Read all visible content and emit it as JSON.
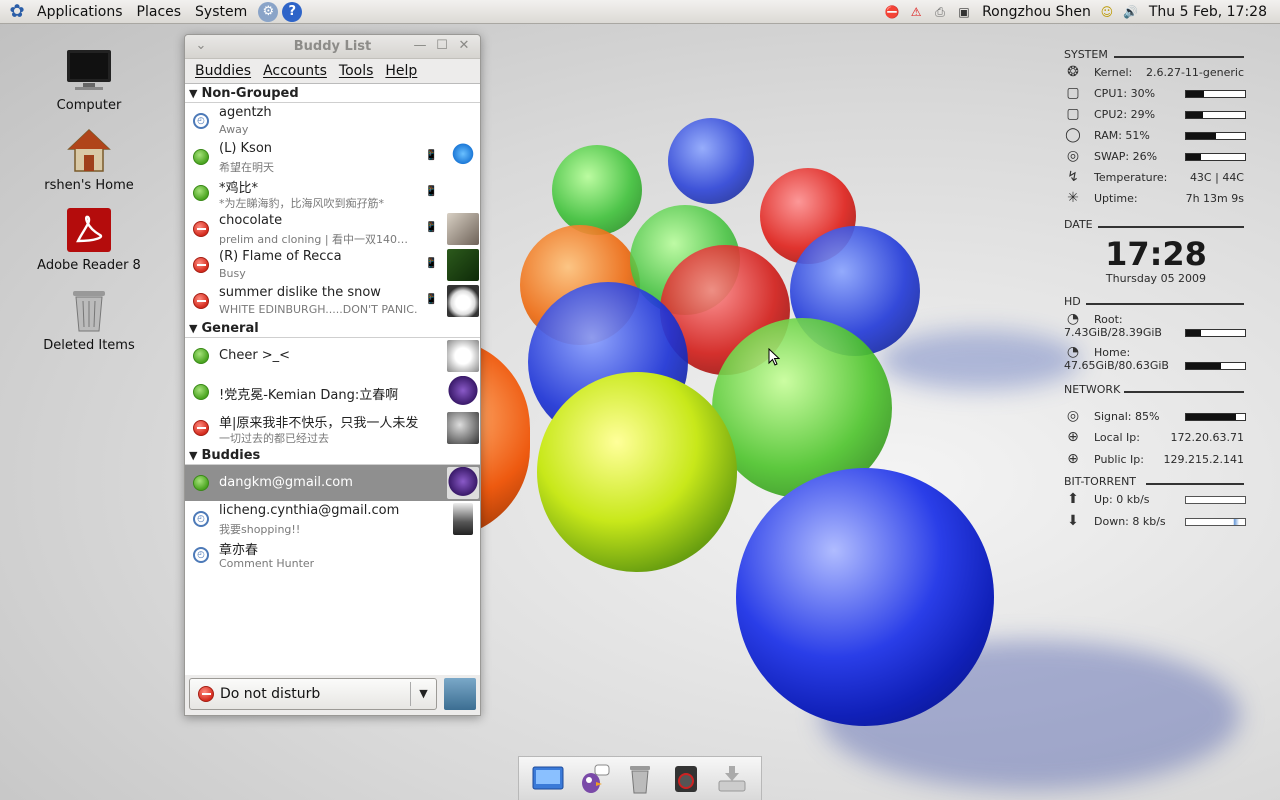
{
  "top_panel": {
    "menus": [
      "Applications",
      "Places",
      "System"
    ],
    "user_name": "Rongzhou Shen",
    "clock": "Thu  5 Feb, 17:28"
  },
  "desktop": {
    "icons": [
      {
        "label": "Computer",
        "icon": "computer-icon"
      },
      {
        "label": "rshen's Home",
        "icon": "home-folder-icon"
      },
      {
        "label": "Adobe Reader 8",
        "icon": "adobe-reader-icon"
      },
      {
        "label": "Deleted Items",
        "icon": "trash-icon"
      }
    ]
  },
  "buddy_window": {
    "title": "Buddy List",
    "menu": [
      "Buddies",
      "Accounts",
      "Tools",
      "Help"
    ],
    "groups": [
      {
        "name": "Non-Grouped",
        "buddies": [
          {
            "name": "agentzh",
            "status_text": "Away",
            "status": "away",
            "mobile": false,
            "avatar": "none"
          },
          {
            "name": "(L) Kson",
            "status_text": "希望在明天",
            "status": "available",
            "mobile": true,
            "avatar": "logo"
          },
          {
            "name": "*鸡比*",
            "status_text": "*为左睇海豹，比海风吹到痴孖筋*",
            "status": "available",
            "mobile": true,
            "avatar": "none"
          },
          {
            "name": "chocolate",
            "status_text": "prelim and cloning | 看中一双140…",
            "status": "busy",
            "mobile": true,
            "avatar": "photo"
          },
          {
            "name": "(R) Flame of Recca",
            "status_text": "Busy",
            "status": "busy",
            "mobile": true,
            "avatar": "green-photo"
          },
          {
            "name": "summer dislike the snow",
            "status_text": "WHITE EDINBURGH.....DON'T PANIC.",
            "status": "busy",
            "mobile": true,
            "avatar": "dog"
          }
        ]
      },
      {
        "name": "General",
        "buddies": [
          {
            "name": "Cheer >_<",
            "status_text": "",
            "status": "available",
            "mobile": false,
            "avatar": "rabbit"
          },
          {
            "name": "!党克冕-Kemian Dang:立春啊",
            "status_text": "",
            "status": "available",
            "mobile": false,
            "avatar": "dragon"
          },
          {
            "name": "单|原来我非不快乐，只我一人未发觉",
            "status_text": "一切过去的都已经过去",
            "status": "busy",
            "mobile": false,
            "avatar": "gray"
          }
        ]
      },
      {
        "name": "Buddies",
        "buddies": [
          {
            "name": "dangkm@gmail.com",
            "status_text": "",
            "status": "available",
            "mobile": false,
            "avatar": "dragon",
            "selected": true
          },
          {
            "name": "licheng.cynthia@gmail.com",
            "status_text": "我要shopping!!",
            "status": "away",
            "mobile": false,
            "avatar": "portrait"
          },
          {
            "name": "章亦春",
            "status_text": "Comment Hunter",
            "status": "away",
            "mobile": false,
            "avatar": "none"
          }
        ]
      }
    ],
    "status_selector": {
      "label": "Do not disturb"
    }
  },
  "conky": {
    "system_title": "SYSTEM",
    "kernel_label": "Kernel:",
    "kernel": "2.6.27-11-generic",
    "cpu1_label": "CPU1: 30%",
    "cpu1": 0.3,
    "cpu2_label": "CPU2: 29%",
    "cpu2": 0.29,
    "ram_label": "RAM: 51%",
    "ram": 0.51,
    "swap_label": "SWAP: 26%",
    "swap": 0.26,
    "temp_label": "Temperature:",
    "temp": "43C | 44C",
    "uptime_label": "Uptime:",
    "uptime": "7h 13m 9s",
    "date_title": "DATE",
    "time": "17:28",
    "date": "Thursday 05 2009",
    "hd_title": "HD",
    "root_label": "Root:",
    "root_value": "7.43GiB/28.39GiB",
    "root_fill": 0.26,
    "home_label": "Home:",
    "home_value": "47.65GiB/80.63GiB",
    "home_fill": 0.59,
    "network_title": "NETWORK",
    "signal_label": "Signal: 85%",
    "signal": 0.85,
    "local_ip_label": "Local Ip:",
    "local_ip": "172.20.63.71",
    "public_ip_label": "Public Ip:",
    "public_ip": "129.215.2.141",
    "bt_title": "BIT-TORRENT",
    "up_label": "Up: 0 kb/s",
    "down_label": "Down: 8 kb/s"
  },
  "dock": {
    "items": [
      "finder-icon",
      "pidgin-icon",
      "trash-icon",
      "speaker-icon",
      "download-icon"
    ]
  }
}
